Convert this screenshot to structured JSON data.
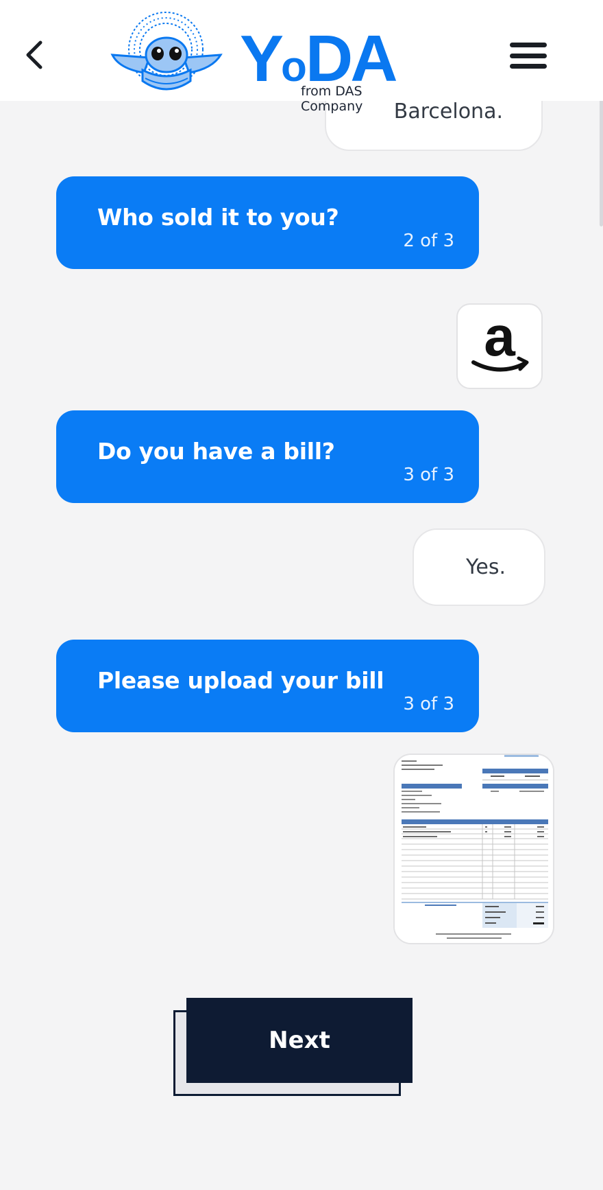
{
  "header": {
    "brand": "YoDA",
    "brand_tagline": "from DAS Company",
    "back_icon": "chevron-left-icon",
    "menu_icon": "hamburger-menu-icon"
  },
  "chat": {
    "messages": [
      {
        "from": "user",
        "text": "Barcelona."
      },
      {
        "from": "bot",
        "text": "Who sold it to you?",
        "count": "2 of 3"
      },
      {
        "from": "user",
        "type": "image",
        "image": "amazon-logo"
      },
      {
        "from": "bot",
        "text": "Do you have a bill?",
        "count": "3 of 3"
      },
      {
        "from": "user",
        "text": "Yes."
      },
      {
        "from": "bot",
        "text": "Please upload your bill",
        "count": "3 of 3"
      },
      {
        "from": "user",
        "type": "image",
        "image": "bill-invoice-thumbnail"
      }
    ]
  },
  "actions": {
    "next_label": "Next"
  },
  "colors": {
    "brand_blue": "#0a78f0",
    "bot_bubble": "#0a7cf5",
    "dark_navy": "#0e1b33",
    "background": "#f4f4f5"
  }
}
